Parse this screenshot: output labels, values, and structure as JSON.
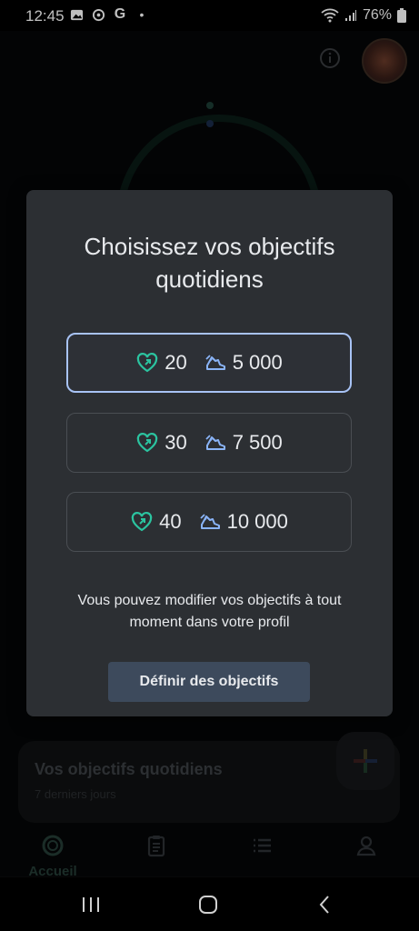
{
  "status_bar": {
    "time": "12:45",
    "battery": "76%"
  },
  "dialog": {
    "title": "Choisissez vos objectifs quotidiens",
    "options": [
      {
        "heart_points": "20",
        "steps": "5 000",
        "selected": true
      },
      {
        "heart_points": "30",
        "steps": "7 500",
        "selected": false
      },
      {
        "heart_points": "40",
        "steps": "10 000",
        "selected": false
      }
    ],
    "hint": "Vous pouvez modifier vos objectifs à tout moment dans votre profil",
    "button_label": "Définir des objectifs"
  },
  "background": {
    "card_title": "Vos objectifs quotidiens",
    "card_subtitle": "7 derniers jours",
    "nav": {
      "home_label": "Accueil"
    }
  },
  "colors": {
    "heart": "#2bc4a0",
    "steps": "#8ab4f8",
    "selected_border": "#a8c3f5"
  }
}
